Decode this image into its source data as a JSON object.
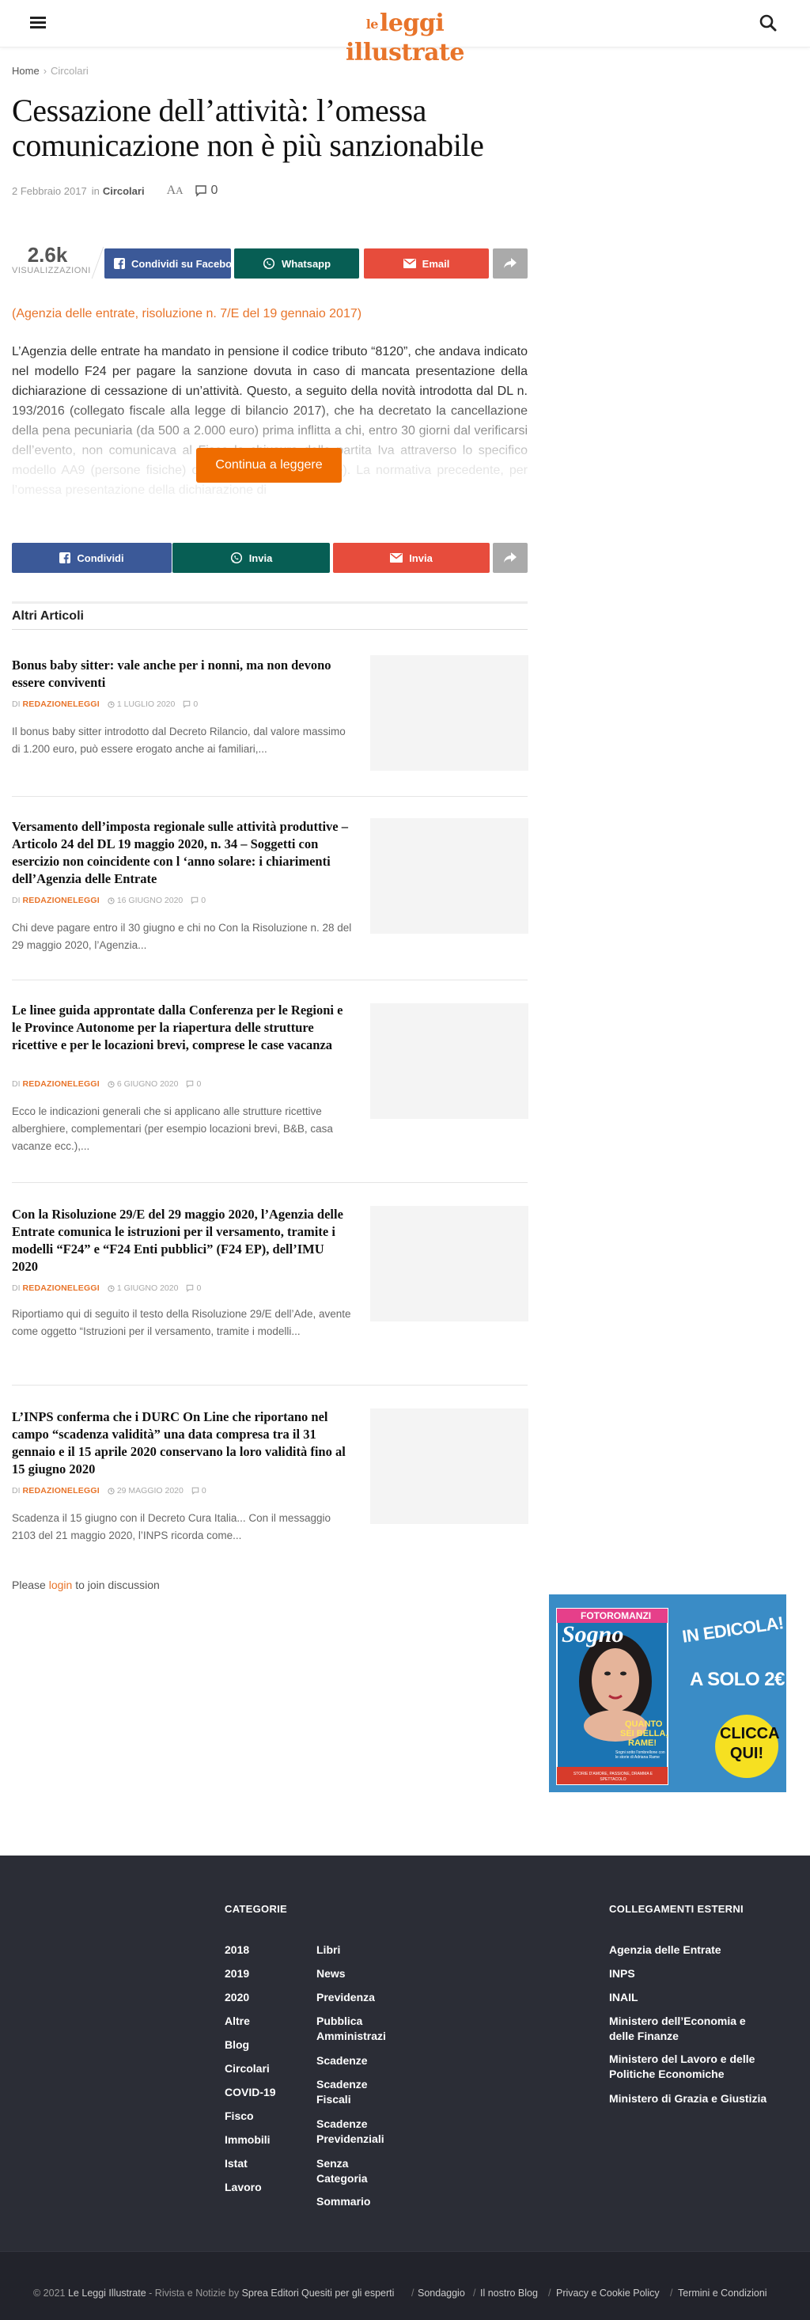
{
  "header": {
    "logo_prefix": "le",
    "logo_main": "leggi illustrate"
  },
  "breadcrumb": {
    "home": "Home",
    "separator": "›",
    "current": "Circolari"
  },
  "article": {
    "title": "Cessazione dell’attività: l’omessa comunicazione non è più sanzionabile",
    "date": "2 Febbraio 2017",
    "in_label": "in",
    "category": "Circolari",
    "font_large": "A",
    "font_small": "A",
    "comments": "0",
    "views_count": "2.6k",
    "views_label": "VISUALIZZAZIONI",
    "source_note": "(Agenzia delle entrate, risoluzione n. 7/E del 19 gennaio 2017)",
    "body": "L’Agenzia delle entrate ha mandato in pensione il codice tributo “8120”, che andava indicato nel modello F24 per pagare la sanzione dovuta in caso di mancata presentazione della dichiarazione di cessazione di un’attività. Questo, a seguito della novità introdotta dal DL n. 193/2016 (collegato fiscale alla legge di bilancio 2017), che ha decretato la cancellazione della pena pecuniaria (da 500 a 2.000 euro) prima inflitta a chi, entro 30 giorni dal verificarsi dell’evento, non comunicava al Fisco la chiusura della partita Iva attraverso lo specifico modello AA9 (persone fisiche) o AA7 (persone giuridiche). La normativa precedente, per l’omessa presentazione della dichiarazione di",
    "continue_label": "Continua a leggere"
  },
  "share_top": {
    "facebook": "Condividi su Facebook",
    "whatsapp": "Whatsapp",
    "email": "Email"
  },
  "share_bottom": {
    "facebook": "Condividi",
    "whatsapp": "Invia",
    "email": "Invia"
  },
  "related": {
    "section_title": "Altri Articoli",
    "by_label": "DI",
    "posts": [
      {
        "title": "Bonus baby sitter: vale anche per i nonni, ma non devono essere conviventi",
        "author": "REDAZIONELEGGI",
        "date": "1 LUGLIO 2020",
        "comments": "0",
        "excerpt": "Il bonus baby sitter introdotto dal Decreto Rilancio, dal valore massimo di 1.200 euro, può essere erogato anche ai familiari,..."
      },
      {
        "title": "Versamento dell’imposta regionale sulle attività produttive – Articolo 24 del DL 19 maggio 2020, n. 34 – Soggetti con esercizio non coincidente con l ‘anno solare: i chiarimenti dell’Agenzia delle Entrate",
        "author": "REDAZIONELEGGI",
        "date": "16 GIUGNO 2020",
        "comments": "0",
        "excerpt": "Chi deve pagare entro il 30 giugno e chi no Con la Risoluzione n. 28 del 29 maggio 2020, l’Agenzia..."
      },
      {
        "title": "Le linee guida approntate dalla Conferenza per le Regioni e le Province Autonome per la riapertura delle strutture ricettive e per le locazioni brevi, comprese le case vacanza",
        "author": "REDAZIONELEGGI",
        "date": "6 GIUGNO 2020",
        "comments": "0",
        "excerpt": "Ecco le indicazioni generali che si applicano alle strutture ricettive alberghiere, complementari (per esempio locazioni brevi, B&B, casa vacanze ecc.),..."
      },
      {
        "title": "Con la Risoluzione 29/E del 29 maggio 2020, l’Agenzia delle Entrate comunica le istruzioni per il versamento, tramite i modelli “F24” e “F24 Enti pubblici” (F24 EP), dell’IMU 2020",
        "author": "REDAZIONELEGGI",
        "date": "1 GIUGNO 2020",
        "comments": "0",
        "excerpt": "Riportiamo qui di seguito il testo della Risoluzione 29/E dell’Ade, avente come oggetto “Istruzioni per il versamento, tramite i modelli..."
      },
      {
        "title": "L’INPS conferma che i DURC On Line che riportano nel campo “scadenza validità” una data compresa tra il 31 gennaio e il 15 aprile 2020 conservano la loro validità fino al 15 giugno 2020",
        "author": "REDAZIONELEGGI",
        "date": "29 MAGGIO 2020",
        "comments": "0",
        "excerpt": "Scadenza il 15 giugno con il Decreto Cura Italia... Con il messaggio 2103 del 21 maggio 2020, l’INPS ricorda come..."
      }
    ]
  },
  "discussion": {
    "pre": "Please",
    "link": "login",
    "post": "to join discussion"
  },
  "ad": {
    "magazine_banner": "FOTOROMANZI",
    "magazine_name": "Sogno",
    "headline_1": "IN EDICOLA!",
    "headline_2": "A SOLO 2€",
    "cta_1": "CLICCA",
    "cta_2": "QUI!",
    "cover_line_1": "QUANTO",
    "cover_line_2": "SEI BELLA,",
    "cover_line_3": "RAME!",
    "cover_sub": "Sogni sotto l'ombrellone con le storie di Adriana Rame",
    "cover_bottom": "STORIE D'AMORE, PASSIONE, DRAMMA E SPETTACOLO"
  },
  "footer": {
    "categories_title": "CATEGORIE",
    "categories_col1": [
      "2018",
      "2019",
      "2020",
      "Altre",
      "Blog",
      "Circolari",
      "COVID-19",
      "Fisco",
      "Immobili",
      "Istat",
      "Lavoro"
    ],
    "categories_col2": [
      "Libri",
      "News",
      "Previdenza",
      "Pubblica Amministrazi",
      "Scadenze",
      "Scadenze Fiscali",
      "Scadenze Previdenziali",
      "Senza Categoria",
      "Sommario"
    ],
    "external_title": "COLLEGAMENTI ESTERNI",
    "external_links": [
      "Agenzia delle Entrate",
      "INPS",
      "INAIL",
      "Ministero dell’Economia e delle Finanze",
      "Ministero del Lavoro e delle Politiche Economiche",
      "Ministero di Grazia e Giustizia"
    ],
    "copyright_pre": "© 2021",
    "copyright_site": "Le Leggi Illustrate",
    "copyright_mid": "- Rivista e Notizie by",
    "copyright_publisher": "Sprea Editori",
    "bottom_links": [
      "Quesiti per gli esperti",
      "Sondaggio",
      "Il nostro Blog",
      "Privacy e Cookie Policy",
      "Termini e Condizioni"
    ],
    "bottom_sep": "/"
  },
  "colors": {
    "accent": "#e8742a",
    "facebook": "#3b5998",
    "whatsapp": "#075e54",
    "email": "#e74c3c",
    "share_more": "#aaaaaa",
    "continue": "#ef6c00",
    "footer_bg": "#2b2d36"
  },
  "icons": {
    "menu": "hamburger-icon",
    "search": "search-icon",
    "comment": "comment-icon",
    "facebook": "facebook-icon",
    "whatsapp": "whatsapp-icon",
    "email": "envelope-icon",
    "share": "share-icon",
    "clock": "clock-icon"
  }
}
